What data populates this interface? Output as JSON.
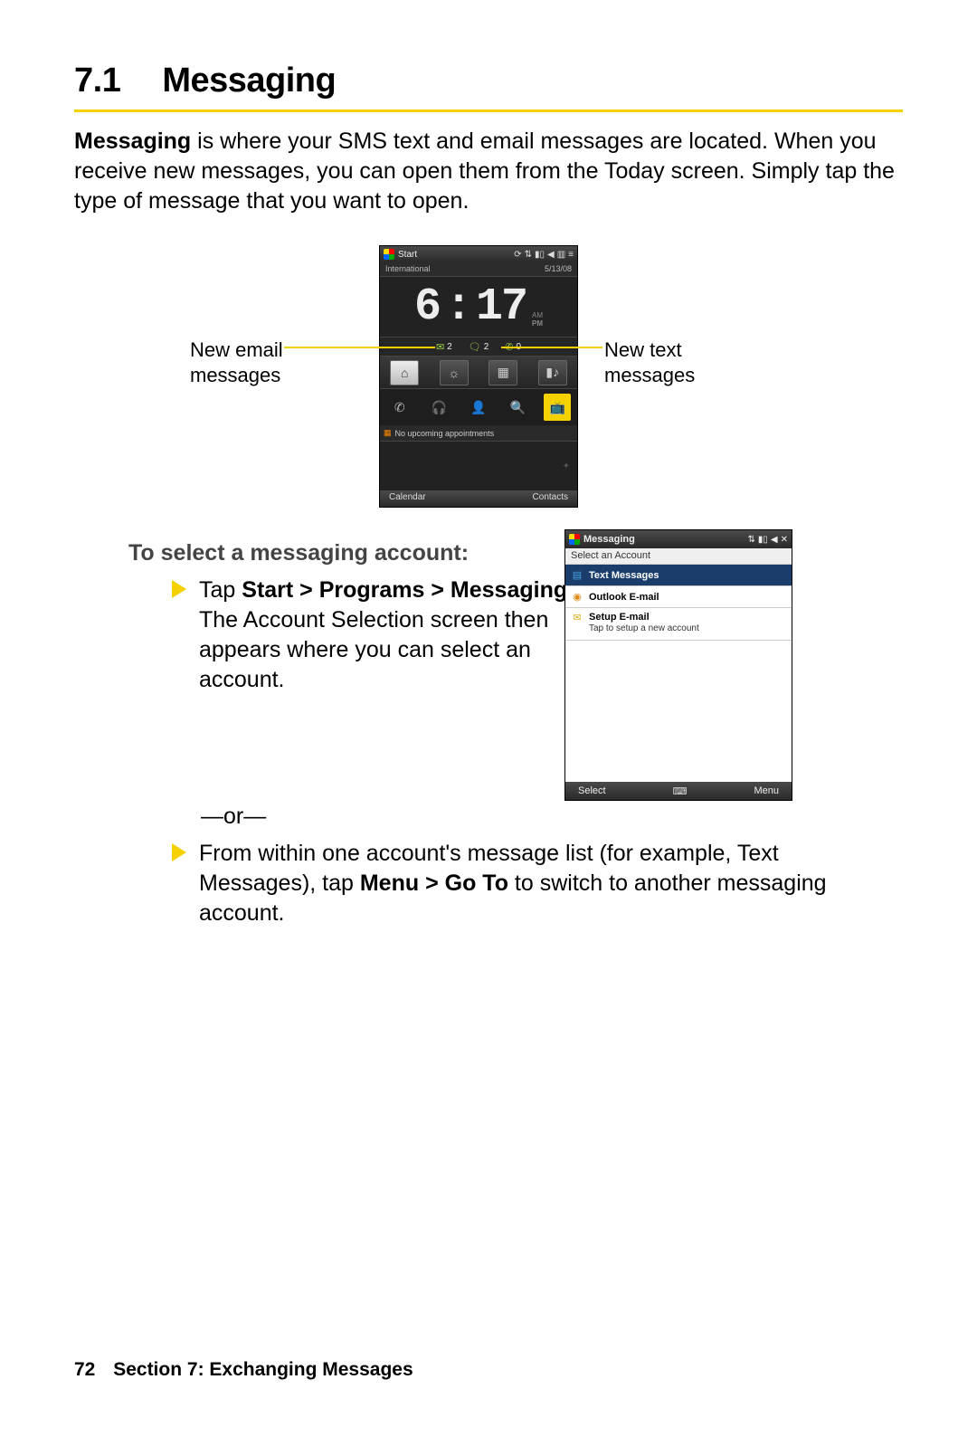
{
  "heading": {
    "number": "7.1",
    "title": "Messaging"
  },
  "intro": {
    "bold_lead": "Messaging",
    "rest": " is where your SMS text and email messages are located. When you receive new messages, you can open them from the Today screen. Simply tap the type of message that you want to open."
  },
  "callouts": {
    "left_line1": "New email",
    "left_line2": "messages",
    "right_line1": "New text",
    "right_line2": "messages"
  },
  "phone1": {
    "start_label": "Start",
    "carrier": "International",
    "date": "5/13/08",
    "time_h": "6",
    "time_m": "17",
    "ampm_top": "AM",
    "ampm_bot": "PM",
    "notif_email": "2",
    "notif_sms": "2",
    "notif_call": "0",
    "appt": "No upcoming appointments",
    "soft_left": "Calendar",
    "soft_right": "Contacts"
  },
  "subhead": "To select a messaging account:",
  "step1": {
    "pre": "Tap ",
    "bold": "Start > Programs > Messaging",
    "post": ". The Account Selection screen then appears where you can select an account."
  },
  "or_text": "—or—",
  "step2": {
    "pre": "From within one account's message list (for example, Text Messages), tap ",
    "bold": "Menu > Go To",
    "post": " to switch to another messaging account."
  },
  "phone2": {
    "title": "Messaging",
    "sub": "Select an Account",
    "item1": "Text Messages",
    "item2": "Outlook E-mail",
    "item3_t": "Setup E-mail",
    "item3_s": "Tap to setup a new account",
    "soft_left": "Select",
    "soft_right": "Menu"
  },
  "footer": {
    "page": "72",
    "section": "Section 7: Exchanging Messages"
  }
}
